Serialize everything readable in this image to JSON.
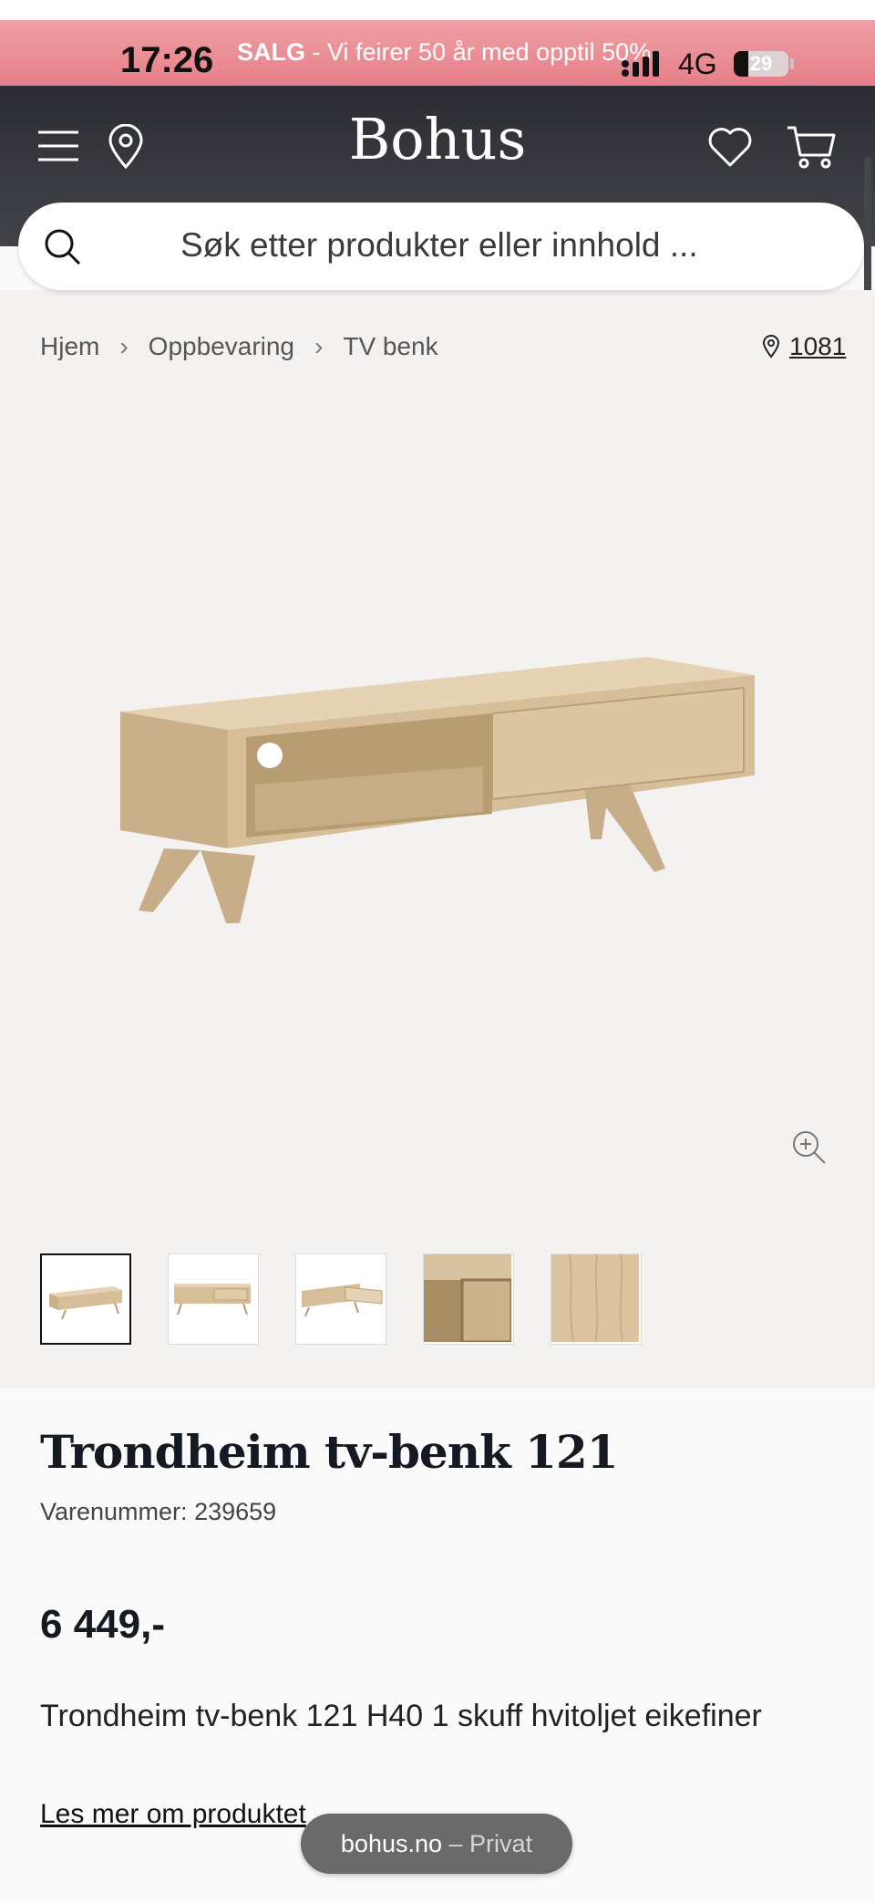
{
  "status_bar": {
    "time": "17:26",
    "network": "4G",
    "battery": "29"
  },
  "promo": {
    "bold": "SALG",
    "text": " - Vi feirer 50 år med opptil 50%"
  },
  "header": {
    "logo": "Bohus"
  },
  "search": {
    "placeholder": "Søk etter produkter eller innhold ..."
  },
  "breadcrumb": [
    "Hjem",
    "Oppbevaring",
    "TV benk"
  ],
  "store": {
    "number": "1081"
  },
  "gallery": {
    "thumbnail_count": 5,
    "active_index": 0
  },
  "product": {
    "title": "Trondheim tv-benk 121",
    "sku_label": "Varenummer:",
    "sku": "239659",
    "price": "6 449,-",
    "description": "Trondheim tv-benk 121 H40 1 skuff hvitoljet eikefiner",
    "read_more": "Les mer om produktet"
  },
  "browser_pill": {
    "domain": "bohus.no",
    "mode": "– Privat"
  },
  "colors": {
    "header": "#2c2d33",
    "promo": "#e67f88",
    "gallery_bg": "#f4f2f1",
    "wood": "#d8c3a0"
  }
}
